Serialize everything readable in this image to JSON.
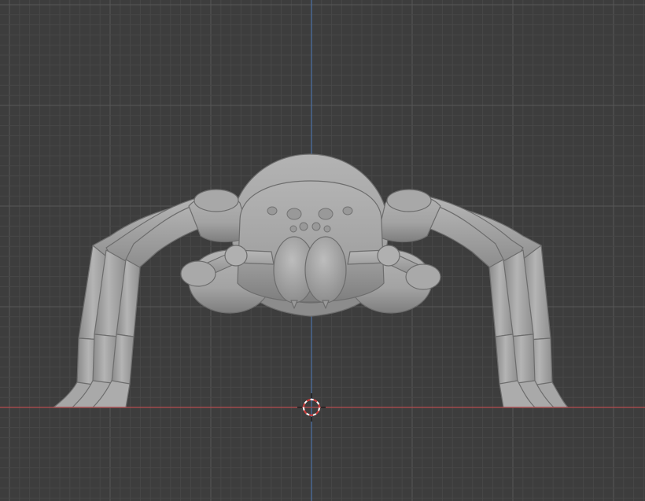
{
  "viewport": {
    "label": "",
    "view": "front-orthographic",
    "background_color": "#3d3d3d",
    "grid_minor_color": "#474747",
    "grid_major_color": "#535353",
    "x_axis_color": "#b24a4c",
    "z_axis_color": "#4b6fa3",
    "model_color": "#a5a5a5",
    "cursor_icon": "3d-cursor-icon"
  },
  "scene": {
    "object": "spider-model",
    "shading": "solid"
  }
}
